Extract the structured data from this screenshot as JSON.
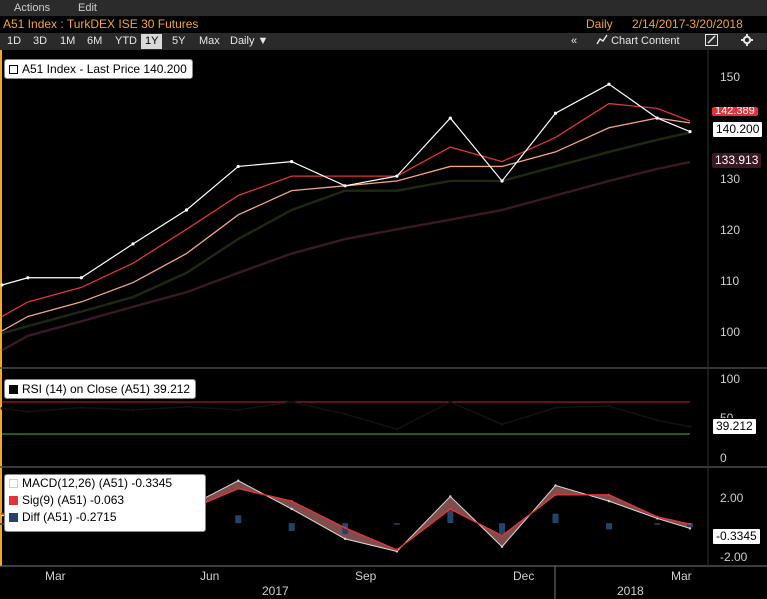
{
  "menu": {
    "actions": "Actions",
    "edit": "Edit"
  },
  "title": {
    "security": "A51 Index : TurkDEX ISE 30 Futures",
    "periodicity": "Daily",
    "date_range": "2/14/2017-3/20/2018"
  },
  "toolbar": {
    "ranges": [
      "1D",
      "3D",
      "1M",
      "6M",
      "YTD",
      "1Y",
      "5Y",
      "Max"
    ],
    "active_range": "1Y",
    "frequency": "Daily ▼",
    "collapse": "«",
    "chart_content": "Chart Content",
    "draw_icon": "pencil-icon",
    "settings_icon": "gear-icon"
  },
  "colors": {
    "background": "#000000",
    "price": "#ffffff",
    "ma_short": "#e0343a",
    "ma_mid": "#f4a37f",
    "ma_long": "#1e2a10",
    "ma_longest": "#3b1826",
    "rsi_upper": "#b7272c",
    "rsi_lower": "#46b539",
    "macd_fill": "#ff9999",
    "histogram": "#22446b"
  },
  "panels": {
    "price": {
      "legend": "A51 Index - Last Price 140.200",
      "last_price_tag": "140.200",
      "ma_tag": "133.913",
      "hidden_tag": "142.389",
      "y_ticks": [
        "150",
        "140",
        "130",
        "120",
        "110",
        "100"
      ]
    },
    "rsi": {
      "legend": "RSI (14) on Close (A51) 39.212",
      "value_tag": "39.212",
      "y_ticks": [
        "100",
        "50",
        "0"
      ]
    },
    "macd": {
      "legend_macd": "MACD(12,26) (A51) -0.3345",
      "legend_sig": "Sig(9) (A51) -0.063",
      "legend_diff": "Diff (A51) -0.2715",
      "value_tag": "-0.3345",
      "y_ticks": [
        "2.00",
        "-2.00"
      ]
    }
  },
  "x_axis": {
    "months": [
      "Mar",
      "Jun",
      "Sep",
      "Dec",
      "Mar"
    ],
    "years": [
      "2017",
      "2018"
    ]
  },
  "chart_data": [
    {
      "type": "line",
      "title": "A51 Index - Last Price 140.200",
      "x": [
        "2017-02-14",
        "2017-03-01",
        "2017-04-01",
        "2017-05-01",
        "2017-06-01",
        "2017-07-01",
        "2017-08-01",
        "2017-09-01",
        "2017-10-01",
        "2017-11-01",
        "2017-12-01",
        "2018-01-01",
        "2018-02-01",
        "2018-03-01",
        "2018-03-20"
      ],
      "series": [
        {
          "name": "A51 Index - Last Price",
          "values": [
            108.5,
            110,
            110,
            117,
            124,
            133,
            134,
            129,
            131,
            143,
            130,
            144,
            150,
            143,
            140.2
          ]
        },
        {
          "values": [
            102,
            105,
            108,
            113,
            120,
            127,
            131,
            131,
            131,
            137,
            134,
            139,
            146,
            145,
            142.4
          ]
        },
        {
          "values": [
            99,
            102,
            105,
            109,
            115,
            123,
            128,
            129,
            130,
            133,
            133,
            136,
            141,
            143,
            142
          ]
        },
        {
          "values": [
            98.5,
            100,
            103,
            106,
            111,
            118,
            124,
            128,
            128,
            130,
            130,
            133,
            136,
            138.5,
            140
          ]
        },
        {
          "values": [
            95,
            98,
            101,
            104,
            107,
            111,
            115,
            118,
            120,
            122,
            124,
            127,
            130,
            132.5,
            133.9
          ]
        }
      ],
      "ylim": [
        93,
        155
      ],
      "y_ticks": [
        100,
        110,
        120,
        130,
        140,
        150
      ],
      "grid": false,
      "legend": "top-left"
    },
    {
      "type": "line",
      "title": "RSI (14) on Close (A51) 39.212",
      "x": [
        "2017-02-14",
        "2017-03-01",
        "2017-04-01",
        "2017-05-01",
        "2017-06-01",
        "2017-07-01",
        "2017-08-01",
        "2017-09-01",
        "2017-10-01",
        "2017-11-01",
        "2017-12-01",
        "2018-01-01",
        "2018-02-01",
        "2018-03-01",
        "2018-03-20"
      ],
      "series": [
        {
          "name": "RSI (14) on Close (A51)",
          "values": [
            62,
            58,
            63,
            60,
            64,
            60,
            70,
            55,
            36,
            70,
            42,
            63,
            65,
            47,
            39.2
          ]
        },
        {
          "values": [
            70,
            70,
            70,
            70,
            70,
            70,
            70,
            70,
            70,
            70,
            70,
            70,
            70,
            70,
            70
          ]
        },
        {
          "values": [
            30,
            30,
            30,
            30,
            30,
            30,
            30,
            30,
            30,
            30,
            30,
            30,
            30,
            30,
            30
          ]
        }
      ],
      "ylim": [
        0,
        100
      ],
      "y_ticks": [
        0,
        50,
        100
      ],
      "legend": "top-left"
    },
    {
      "type": "line",
      "title": "MACD(12,26) (A51)",
      "x": [
        "2017-02-14",
        "2017-03-01",
        "2017-04-01",
        "2017-05-01",
        "2017-06-01",
        "2017-07-01",
        "2017-08-01",
        "2017-09-01",
        "2017-10-01",
        "2017-11-01",
        "2017-12-01",
        "2018-01-01",
        "2018-02-01",
        "2018-03-01",
        "2018-03-20"
      ],
      "series": [
        {
          "name": "MACD(12,26) (A51)",
          "values": [
            0.5,
            0.1,
            1.0,
            0.6,
            1.0,
            2.7,
            0.9,
            -1.0,
            -1.8,
            1.7,
            -1.5,
            2.4,
            1.4,
            0.3,
            -0.3345
          ]
        },
        {
          "name": "Sig(9) (A51)",
          "values": [
            0.6,
            0.3,
            0.7,
            0.8,
            0.8,
            2.2,
            1.4,
            -0.3,
            -1.7,
            0.9,
            -0.8,
            1.8,
            1.8,
            0.4,
            -0.063
          ]
        },
        {
          "name": "Diff (A51)",
          "type": "bar",
          "values": [
            -0.1,
            -0.2,
            0.3,
            -0.2,
            0.2,
            0.5,
            -0.5,
            -0.7,
            -0.1,
            0.8,
            -0.7,
            0.6,
            -0.4,
            -0.1,
            -0.2715
          ]
        }
      ],
      "ylim": [
        -2.6,
        3.0
      ],
      "y_ticks": [
        -2,
        2
      ],
      "legend": "top-left"
    }
  ]
}
